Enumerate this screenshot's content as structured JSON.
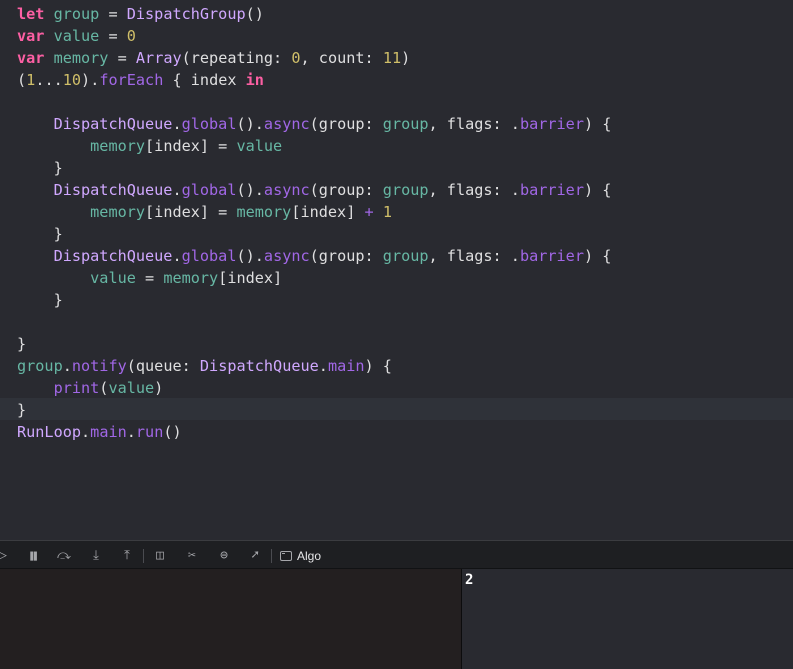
{
  "editor": {
    "lines": [
      [
        {
          "t": "let",
          "c": "kw"
        },
        {
          "t": " "
        },
        {
          "t": "group",
          "c": "var"
        },
        {
          "t": " = "
        },
        {
          "t": "DispatchGroup",
          "c": "type"
        },
        {
          "t": "()"
        }
      ],
      [
        {
          "t": "var",
          "c": "kw"
        },
        {
          "t": " "
        },
        {
          "t": "value",
          "c": "var"
        },
        {
          "t": " = "
        },
        {
          "t": "0",
          "c": "num"
        }
      ],
      [
        {
          "t": "var",
          "c": "kw"
        },
        {
          "t": " "
        },
        {
          "t": "memory",
          "c": "var"
        },
        {
          "t": " = "
        },
        {
          "t": "Array",
          "c": "type"
        },
        {
          "t": "(repeating: "
        },
        {
          "t": "0",
          "c": "num"
        },
        {
          "t": ", count: "
        },
        {
          "t": "11",
          "c": "num"
        },
        {
          "t": ")"
        }
      ],
      [
        {
          "t": "("
        },
        {
          "t": "1",
          "c": "num"
        },
        {
          "t": "..."
        },
        {
          "t": "10",
          "c": "num"
        },
        {
          "t": ")."
        },
        {
          "t": "forEach",
          "c": "func"
        },
        {
          "t": " { index "
        },
        {
          "t": "in",
          "c": "kw"
        }
      ],
      [],
      [
        {
          "t": "    "
        },
        {
          "t": "DispatchQueue",
          "c": "type"
        },
        {
          "t": "."
        },
        {
          "t": "global",
          "c": "func"
        },
        {
          "t": "()."
        },
        {
          "t": "async",
          "c": "func"
        },
        {
          "t": "(group: "
        },
        {
          "t": "group",
          "c": "var"
        },
        {
          "t": ", flags: ."
        },
        {
          "t": "barrier",
          "c": "enumc"
        },
        {
          "t": ") {"
        }
      ],
      [
        {
          "t": "        "
        },
        {
          "t": "memory",
          "c": "var"
        },
        {
          "t": "[index] = "
        },
        {
          "t": "value",
          "c": "var"
        }
      ],
      [
        {
          "t": "    }"
        }
      ],
      [
        {
          "t": "    "
        },
        {
          "t": "DispatchQueue",
          "c": "type"
        },
        {
          "t": "."
        },
        {
          "t": "global",
          "c": "func"
        },
        {
          "t": "()."
        },
        {
          "t": "async",
          "c": "func"
        },
        {
          "t": "(group: "
        },
        {
          "t": "group",
          "c": "var"
        },
        {
          "t": ", flags: ."
        },
        {
          "t": "barrier",
          "c": "enumc"
        },
        {
          "t": ") {"
        }
      ],
      [
        {
          "t": "        "
        },
        {
          "t": "memory",
          "c": "var"
        },
        {
          "t": "[index] = "
        },
        {
          "t": "memory",
          "c": "var"
        },
        {
          "t": "[index] "
        },
        {
          "t": "+",
          "c": "func"
        },
        {
          "t": " "
        },
        {
          "t": "1",
          "c": "num"
        }
      ],
      [
        {
          "t": "    }"
        }
      ],
      [
        {
          "t": "    "
        },
        {
          "t": "DispatchQueue",
          "c": "type"
        },
        {
          "t": "."
        },
        {
          "t": "global",
          "c": "func"
        },
        {
          "t": "()."
        },
        {
          "t": "async",
          "c": "func"
        },
        {
          "t": "(group: "
        },
        {
          "t": "group",
          "c": "var"
        },
        {
          "t": ", flags: ."
        },
        {
          "t": "barrier",
          "c": "enumc"
        },
        {
          "t": ") {"
        }
      ],
      [
        {
          "t": "        "
        },
        {
          "t": "value",
          "c": "var"
        },
        {
          "t": " = "
        },
        {
          "t": "memory",
          "c": "var"
        },
        {
          "t": "[index]"
        }
      ],
      [
        {
          "t": "    }"
        }
      ],
      [],
      [
        {
          "t": "}"
        }
      ],
      [
        {
          "t": "group",
          "c": "var"
        },
        {
          "t": "."
        },
        {
          "t": "notify",
          "c": "func"
        },
        {
          "t": "(queue: "
        },
        {
          "t": "DispatchQueue",
          "c": "type"
        },
        {
          "t": "."
        },
        {
          "t": "main",
          "c": "func"
        },
        {
          "t": ") {"
        }
      ],
      [
        {
          "t": "    "
        },
        {
          "t": "print",
          "c": "func"
        },
        {
          "t": "("
        },
        {
          "t": "value",
          "c": "var"
        },
        {
          "t": ")"
        }
      ],
      [
        {
          "t": "}"
        }
      ],
      [
        {
          "t": "RunLoop",
          "c": "type"
        },
        {
          "t": "."
        },
        {
          "t": "main",
          "c": "func"
        },
        {
          "t": "."
        },
        {
          "t": "run",
          "c": "func"
        },
        {
          "t": "()"
        }
      ]
    ]
  },
  "debug_bar": {
    "icons": [
      {
        "name": "continue-icon",
        "glyph": "▷"
      },
      {
        "name": "pause-icon",
        "glyph": "❚❚"
      },
      {
        "name": "step-over-icon",
        "glyph": "⤼"
      },
      {
        "name": "step-into-icon",
        "glyph": "⤓"
      },
      {
        "name": "step-out-icon",
        "glyph": "⤒"
      },
      {
        "name": "view-hierarchy-icon",
        "glyph": "◫"
      },
      {
        "name": "memory-graph-icon",
        "glyph": "✂"
      },
      {
        "name": "environment-overrides-icon",
        "glyph": "⊜"
      },
      {
        "name": "simulate-location-icon",
        "glyph": "➚"
      }
    ],
    "scheme_label": "Algo",
    "scheme_icon": "terminal-icon"
  },
  "console": {
    "output": "2"
  }
}
